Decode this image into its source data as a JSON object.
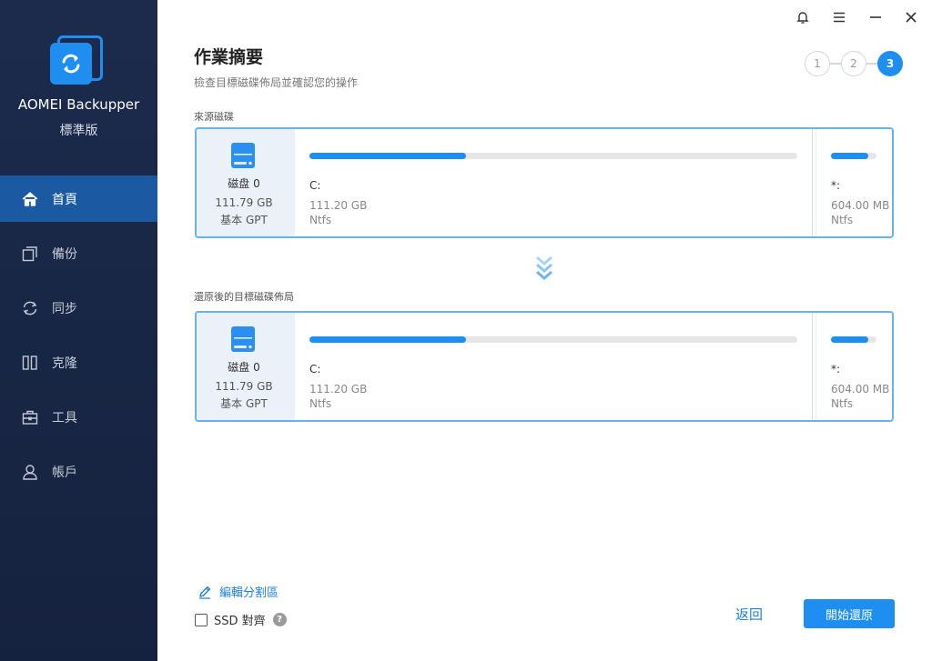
{
  "app": {
    "name": "AOMEI Backupper",
    "edition": "標準版"
  },
  "sidebar": {
    "items": [
      {
        "label": "首頁",
        "icon": "home-icon",
        "active": true
      },
      {
        "label": "備份",
        "icon": "backup-icon"
      },
      {
        "label": "同步",
        "icon": "sync-icon"
      },
      {
        "label": "克隆",
        "icon": "clone-icon"
      },
      {
        "label": "工具",
        "icon": "tools-icon"
      },
      {
        "label": "帳戶",
        "icon": "account-icon"
      }
    ]
  },
  "header": {
    "title": "作業摘要",
    "subtitle": "檢查目標磁碟佈局並確認您的操作",
    "steps": [
      "1",
      "2",
      "3"
    ],
    "current_step": 3
  },
  "source": {
    "label": "來源磁碟",
    "disk": {
      "name": "磁盘 0",
      "size": "111.79 GB",
      "type": "基本 GPT"
    },
    "partitions": [
      {
        "letter": "C:",
        "size": "111.20 GB",
        "fs": "Ntfs",
        "used_fraction": 0.32
      },
      {
        "letter": "*:",
        "size": "604.00 MB",
        "fs": "Ntfs",
        "used_fraction": 0.82
      }
    ]
  },
  "target": {
    "label": "還原後的目標磁碟佈局",
    "disk": {
      "name": "磁盘 0",
      "size": "111.79 GB",
      "type": "基本 GPT"
    },
    "partitions": [
      {
        "letter": "C:",
        "size": "111.20 GB",
        "fs": "Ntfs",
        "used_fraction": 0.32
      },
      {
        "letter": "*:",
        "size": "604.00 MB",
        "fs": "Ntfs",
        "used_fraction": 0.82
      }
    ]
  },
  "footer": {
    "edit_partitions": "編輯分割區",
    "ssd_align": "SSD 對齊",
    "help": "?",
    "back": "返回",
    "start": "開始還原"
  },
  "colors": {
    "accent": "#1e8ff0",
    "sidebar": "#1c2b4c",
    "active_nav": "#1b5aa3"
  }
}
